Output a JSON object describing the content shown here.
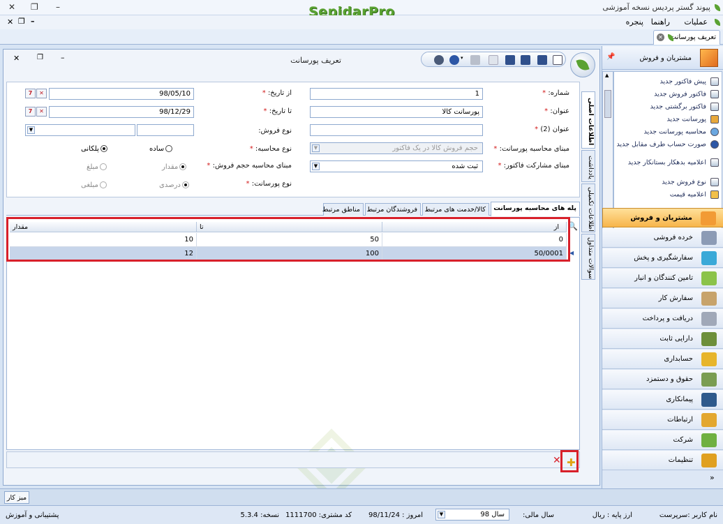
{
  "app": {
    "title": "پیوند گستر پردیس نسخه آموزشی",
    "logo": "SepidarPro"
  },
  "menu": [
    "عملیات",
    "راهنما",
    "پنجره"
  ],
  "doc_tab": {
    "label": "تعريف پورسانت"
  },
  "window": {
    "title": "تعريف پورسانت"
  },
  "form": {
    "number_label": "شماره:",
    "number_value": "1",
    "title_label": "عنوان:",
    "title_value": "پورسانت کالا",
    "title2_label": "عنوان (2)",
    "title2_value": "",
    "base_label": "مبنای محاسبه پورسانت:",
    "base_value": "حجم فروش کالا در یک فاکتور",
    "invoice_share_label": "مبنای مشارکت فاکتور:",
    "invoice_share_value": "ثبت شده",
    "from_date_label": "از تاریخ:",
    "from_date_value": "98/05/10",
    "to_date_label": "تا تاریخ:",
    "to_date_value": "98/12/29",
    "sale_type_label": "نوع فروش:",
    "calc_type_label": "نوع محاسبه:",
    "calc_simple": "ساده",
    "calc_step": "پلکانی",
    "volume_base_label": "مبنای محاسبه حجم فروش:",
    "volume_qty": "مقدار",
    "volume_amount": "مبلغ",
    "commission_type_label": "نوع پورسانت:",
    "commission_percent": "درصدی",
    "commission_amount": "مبلغی"
  },
  "vtabs": [
    "اطلاعات اصلی",
    "یادداشت",
    "اطلاعات تکمیلی",
    "سوالات متداول"
  ],
  "inner_tabs": [
    "پله های محاسبه پورسانت",
    "کالا/خدمت های مرتبط",
    "فروشندگان مرتبط",
    "مناطق مرتبط"
  ],
  "grid": {
    "columns": [
      "از",
      "تا",
      "مقدار"
    ],
    "rows": [
      [
        "0",
        "50",
        "10"
      ],
      [
        "50/0001",
        "100",
        "12"
      ]
    ]
  },
  "nav": {
    "header": "مشتریان و فروش",
    "subitems": [
      "پیش فاکتور جدید",
      "فاکتور فروش جدید",
      "فاکتور برگشتی جدید",
      "پورسانت جدید",
      "محاسبه پورسانت جدید",
      "صورت حساب طرف مقابل جدید",
      "اعلامیه بدهکار بستانکار جدید",
      "نوع فروش جدید",
      "اعلامیه قیمت"
    ],
    "sections": [
      "مشتریان و فروش",
      "خرده فروشی",
      "سفارشگیری و پخش",
      "تامین کنندگان و انبار",
      "سفارش کار",
      "دریافت و پرداخت",
      "دارایی ثابت",
      "حسابداری",
      "حقوق و دستمزد",
      "پیمانکاری",
      "ارتباطات",
      "شرکت",
      "تنظیمات"
    ],
    "section_colors": [
      "#f29b35",
      "#8c9bb5",
      "#3aa9d8",
      "#8bc34a",
      "#c7a36b",
      "#a0a8b8",
      "#6d8f3a",
      "#e7b52b",
      "#7a9d52",
      "#2f5a8c",
      "#e3a72f",
      "#6fb041",
      "#e0a020"
    ]
  },
  "taskbar": {
    "desk": "میز کار"
  },
  "status": {
    "user": "نام کاربر :سرپرست",
    "currency": "ارز پایه : ریال",
    "fiscal_label": "سال مالی:",
    "fiscal_value": "سال 98",
    "today": "امروز : 98/11/24",
    "customer_code": "کد مشتری: 1111700",
    "version": "نسخه: 5.3.4",
    "support": "پشتیبانی و آموزش"
  }
}
